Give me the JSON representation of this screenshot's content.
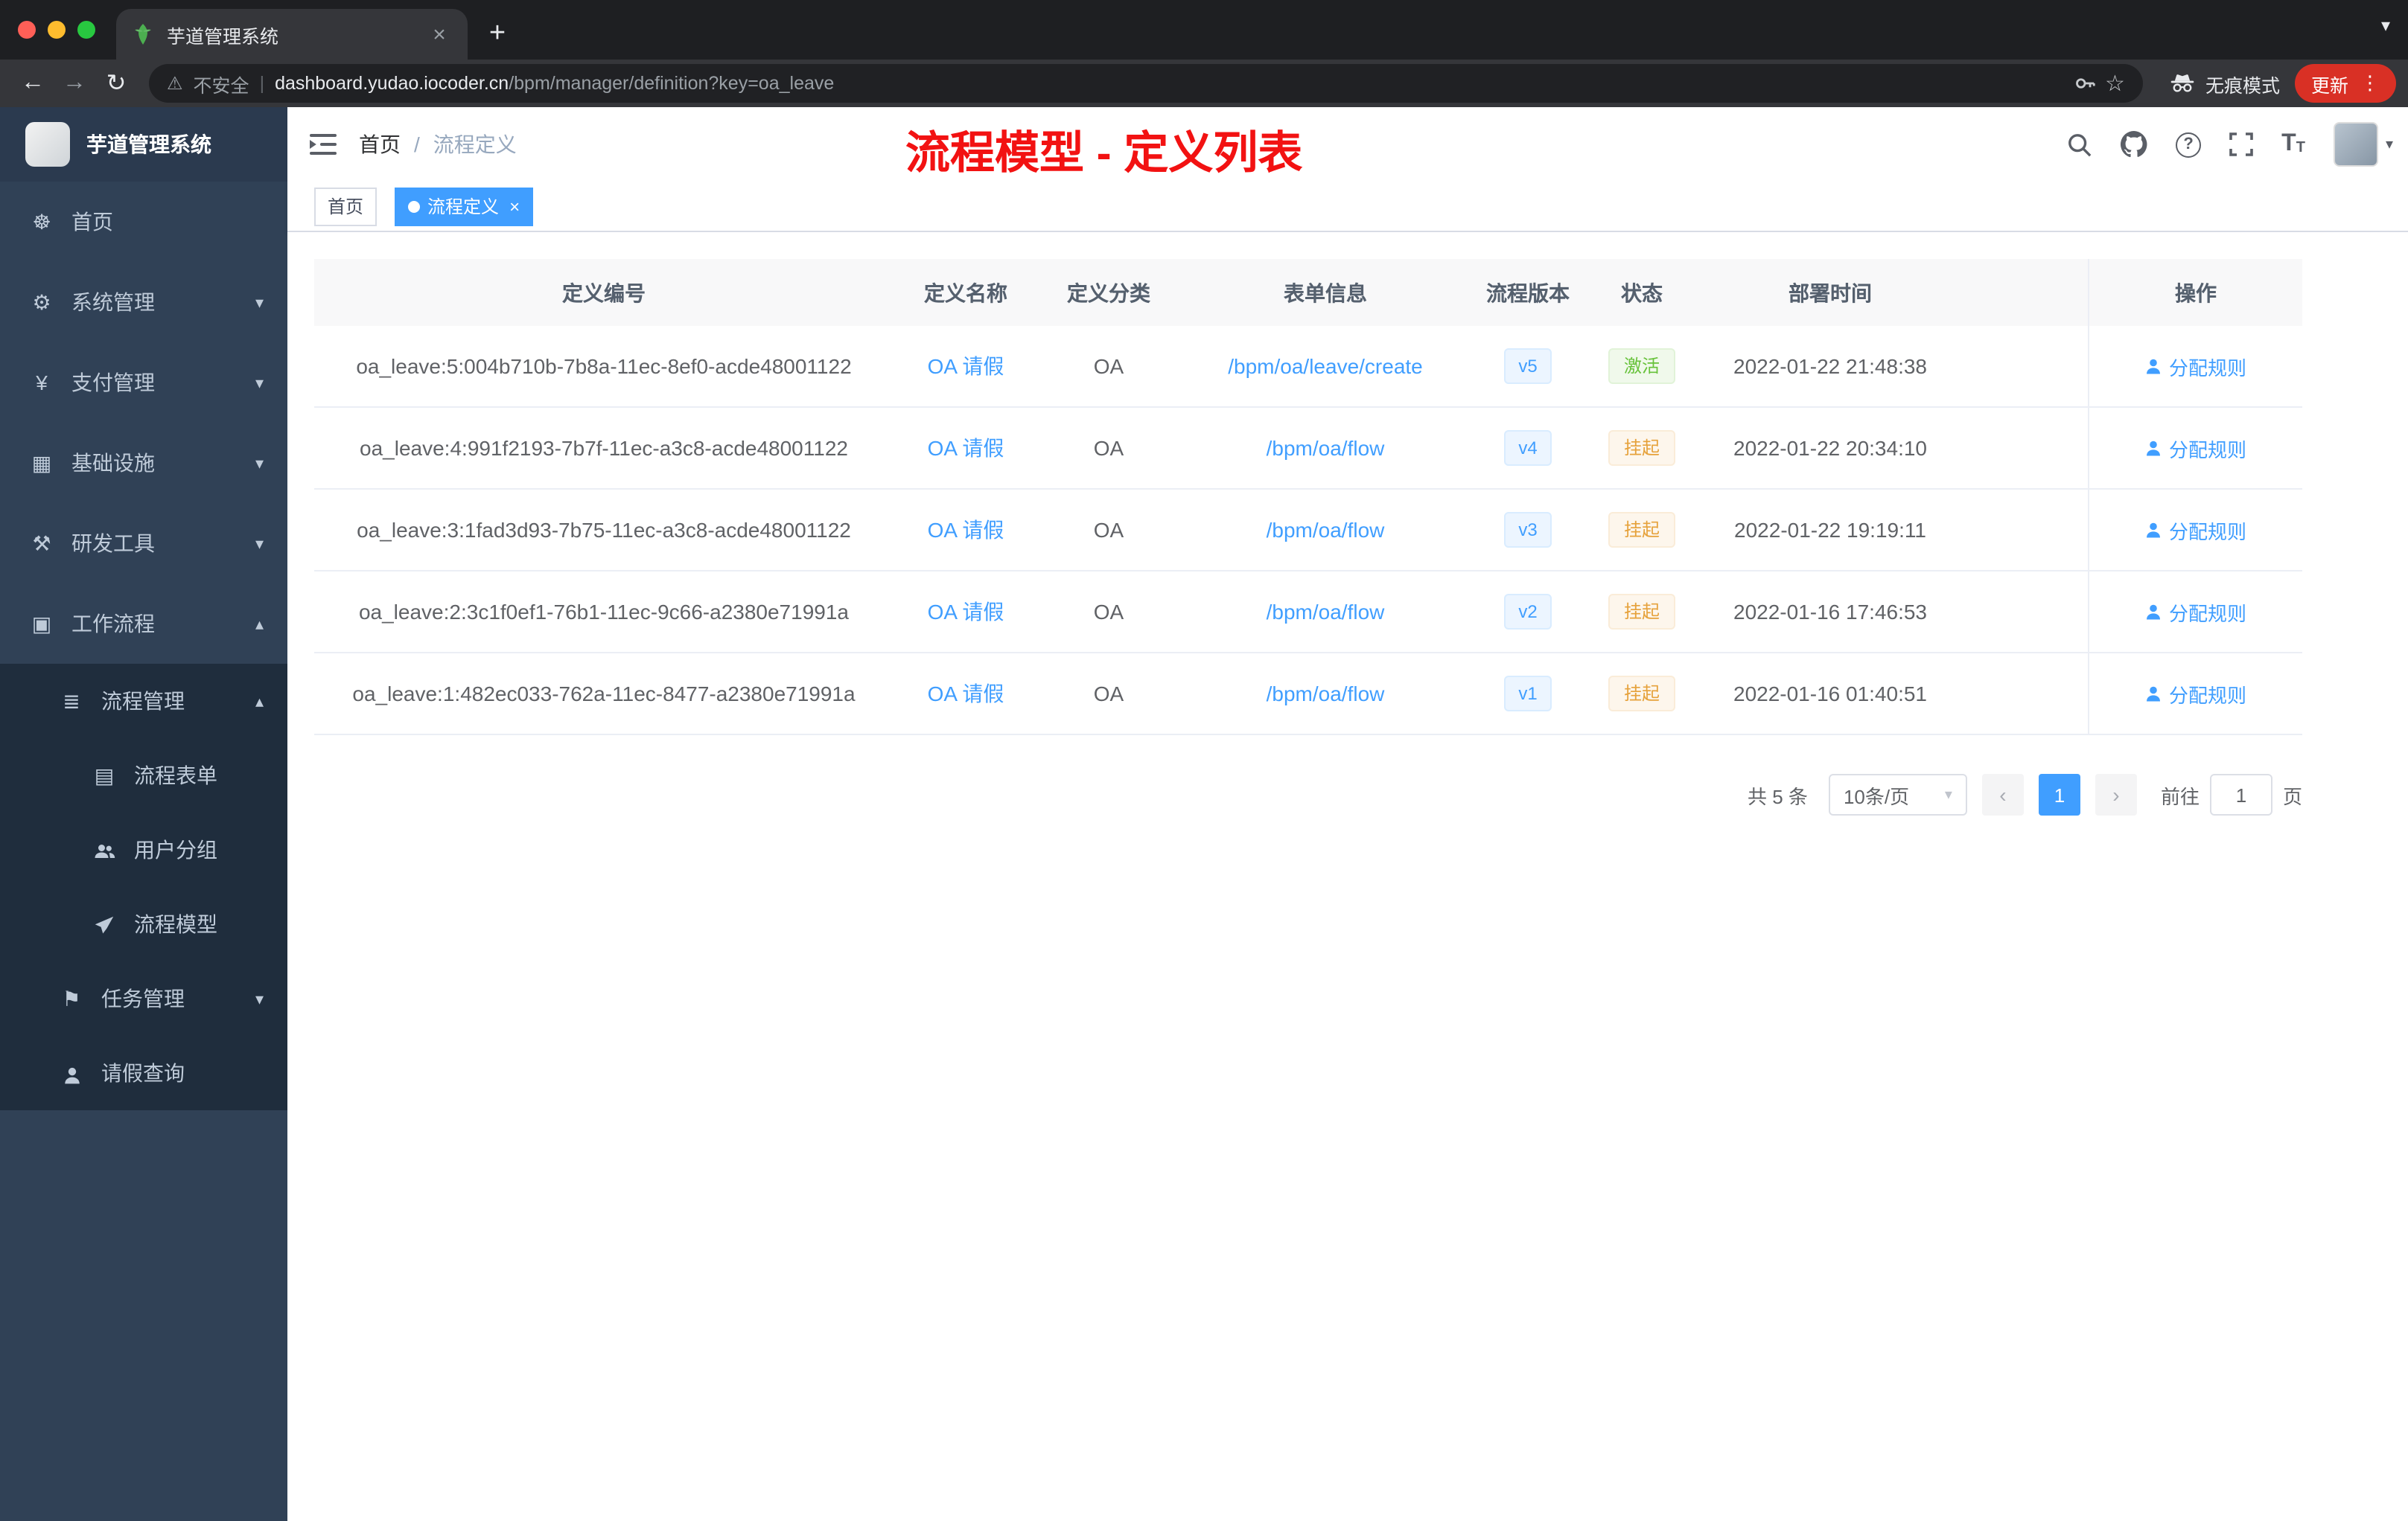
{
  "colors": {
    "accent": "#409eff",
    "success": "#67c23a",
    "warning": "#e6a23c",
    "annotation_red": "#f21212",
    "sidebar_bg": "#304156",
    "submenu_bg": "#1f2d3d",
    "active_tag_bg": "#409eff"
  },
  "browser": {
    "tab_title": "芋道管理系统",
    "security_label": "不安全",
    "url_domain": "dashboard.yudao.iocoder.cn",
    "url_path": "/bpm/manager/definition?key=oa_leave",
    "incognito_label": "无痕模式",
    "update_label": "更新"
  },
  "icons": {
    "back": "←",
    "forward": "→",
    "reload": "↻",
    "warning": "⚠",
    "divider": "|",
    "star": "☆",
    "dots": "⋮",
    "plus": "+",
    "close": "×",
    "tab_caret": "▾",
    "chevron_down": "▾",
    "chevron_up": "▴",
    "breadcrumb_separator": "/",
    "help": "?",
    "font_large": "T",
    "font_small": "T",
    "avatar_caret": "▾",
    "tag_close": "×",
    "select_caret": "▾",
    "prev": "‹",
    "next": "›"
  },
  "sidebar": {
    "logo_title": "芋道管理系统",
    "items": [
      {
        "label": "首页",
        "icon": "☸"
      },
      {
        "label": "系统管理",
        "icon": "⚙"
      },
      {
        "label": "支付管理",
        "icon": "¥"
      },
      {
        "label": "基础设施",
        "icon": "▦"
      },
      {
        "label": "研发工具",
        "icon": "⚒"
      },
      {
        "label": "工作流程",
        "icon": "▣"
      },
      {
        "label": "流程管理",
        "icon": "≣"
      },
      {
        "label": "流程表单",
        "icon": "▤"
      },
      {
        "label": "用户分组",
        "icon": ""
      },
      {
        "label": "流程模型",
        "icon": ""
      },
      {
        "label": "任务管理",
        "icon": "⚑"
      },
      {
        "label": "请假查询",
        "icon": ""
      }
    ]
  },
  "header": {
    "breadcrumb_home": "首页",
    "breadcrumb_current": "流程定义",
    "annotation": "流程模型 - 定义列表"
  },
  "tags": {
    "home": "首页",
    "current": "流程定义"
  },
  "table": {
    "columns": [
      "定义编号",
      "定义名称",
      "定义分类",
      "表单信息",
      "流程版本",
      "状态",
      "部署时间",
      "操作"
    ],
    "rows": [
      {
        "id": "oa_leave:5:004b710b-7b8a-11ec-8ef0-acde48001122",
        "name": "OA 请假",
        "category": "OA",
        "form": "/bpm/oa/leave/create",
        "version": "v5",
        "status": "激活",
        "time": "2022-01-22 21:48:38",
        "action": "分配规则"
      },
      {
        "id": "oa_leave:4:991f2193-7b7f-11ec-a3c8-acde48001122",
        "name": "OA 请假",
        "category": "OA",
        "form": "/bpm/oa/flow",
        "version": "v4",
        "status": "挂起",
        "time": "2022-01-22 20:34:10",
        "action": "分配规则"
      },
      {
        "id": "oa_leave:3:1fad3d93-7b75-11ec-a3c8-acde48001122",
        "name": "OA 请假",
        "category": "OA",
        "form": "/bpm/oa/flow",
        "version": "v3",
        "status": "挂起",
        "time": "2022-01-22 19:19:11",
        "action": "分配规则"
      },
      {
        "id": "oa_leave:2:3c1f0ef1-76b1-11ec-9c66-a2380e71991a",
        "name": "OA 请假",
        "category": "OA",
        "form": "/bpm/oa/flow",
        "version": "v2",
        "status": "挂起",
        "time": "2022-01-16 17:46:53",
        "action": "分配规则"
      },
      {
        "id": "oa_leave:1:482ec033-762a-11ec-8477-a2380e71991a",
        "name": "OA 请假",
        "category": "OA",
        "form": "/bpm/oa/flow",
        "version": "v1",
        "status": "挂起",
        "time": "2022-01-16 01:40:51",
        "action": "分配规则"
      }
    ]
  },
  "pagination": {
    "total": "共 5 条",
    "page_size": "10条/页",
    "page": "1",
    "goto_label": "前往",
    "goto_value": "1",
    "unit": "页"
  }
}
